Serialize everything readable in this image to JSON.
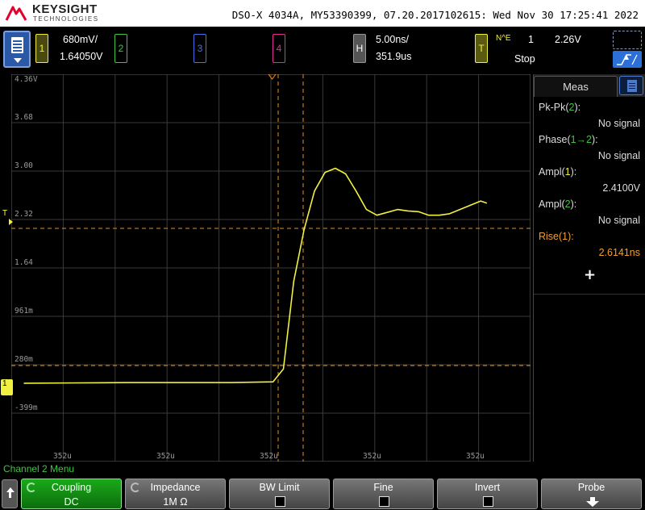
{
  "header": {
    "brand": "KEYSIGHT",
    "brand_sub": "TECHNOLOGIES",
    "instrument_info": "DSO-X 4034A, MY53390399, 07.20.2017102615: Wed Nov 30 17:25:41 2022"
  },
  "channels": {
    "ch1": {
      "number": "1",
      "scale": "680mV/",
      "offset": "1.64050V",
      "color": "#f0f040"
    },
    "ch2": {
      "number": "2",
      "color": "#3ec63e"
    },
    "ch3": {
      "number": "3",
      "color": "#4a6ee8"
    },
    "ch4": {
      "number": "4",
      "color": "#e0309a"
    }
  },
  "horizontal": {
    "label": "H",
    "timebase": "5.00ns/",
    "delay": "351.9us"
  },
  "trigger": {
    "label": "T",
    "mode_symbol": "N^E",
    "source": "1",
    "level": "2.26V",
    "state": "Stop"
  },
  "graticule": {
    "y_labels": [
      "4.36V",
      "3.68",
      "3.00",
      "2.32",
      "1.64",
      "961m",
      "280m",
      "-399m"
    ],
    "x_labels": [
      "352u",
      "352u",
      "352u",
      "352u",
      "352u"
    ],
    "trigger_marker": "T",
    "ground_marker": "1"
  },
  "waveform": {
    "channel": "1",
    "color": "#f0f040",
    "time_unit": "ns",
    "voltage_unit": "V",
    "points": [
      [
        -25,
        0.02
      ],
      [
        -20,
        0.025
      ],
      [
        -15,
        0.03
      ],
      [
        -10,
        0.03
      ],
      [
        -5,
        0.03
      ],
      [
        -1,
        0.04
      ],
      [
        0,
        0.22
      ],
      [
        1,
        1.45
      ],
      [
        2,
        2.18
      ],
      [
        3,
        2.72
      ],
      [
        4,
        2.98
      ],
      [
        5,
        3.04
      ],
      [
        6,
        2.96
      ],
      [
        7,
        2.72
      ],
      [
        8,
        2.46
      ],
      [
        9,
        2.38
      ],
      [
        10,
        2.42
      ],
      [
        11,
        2.46
      ],
      [
        12,
        2.44
      ],
      [
        13,
        2.43
      ],
      [
        14,
        2.38
      ],
      [
        15,
        2.38
      ],
      [
        16,
        2.4
      ],
      [
        17,
        2.46
      ],
      [
        18,
        2.52
      ],
      [
        19,
        2.58
      ],
      [
        19.6,
        2.55
      ]
    ]
  },
  "measurements": {
    "title": "Meas",
    "items": [
      {
        "name": "Pk-Pk(",
        "ch": "2",
        "end": "):",
        "value": "No signal",
        "ch_color": "#3ec63e",
        "color": "#dddddd"
      },
      {
        "name": "Phase(",
        "ch": "1→2",
        "end": "):",
        "value": "No signal",
        "ch_color": "#3ec63e",
        "color": "#dddddd"
      },
      {
        "name": "Ampl(",
        "ch": "1",
        "end": "):",
        "value": "2.4100V",
        "ch_color": "#f0f040",
        "color": "#dddddd"
      },
      {
        "name": "Ampl(",
        "ch": "2",
        "end": "):",
        "value": "No signal",
        "ch_color": "#3ec63e",
        "color": "#dddddd"
      },
      {
        "name": "Rise(",
        "ch": "1",
        "end": "):",
        "value": "2.6141ns",
        "ch_color": "#f0a030",
        "color": "#f0a030"
      }
    ],
    "add_symbol": "+"
  },
  "softkeys": {
    "menu_title": "Channel 2 Menu",
    "coupling": {
      "label": "Coupling",
      "value": "DC"
    },
    "impedance": {
      "label": "Impedance",
      "value": "1M Ω"
    },
    "bw_limit": {
      "label": "BW Limit"
    },
    "fine": {
      "label": "Fine"
    },
    "invert": {
      "label": "Invert"
    },
    "probe": {
      "label": "Probe"
    }
  }
}
